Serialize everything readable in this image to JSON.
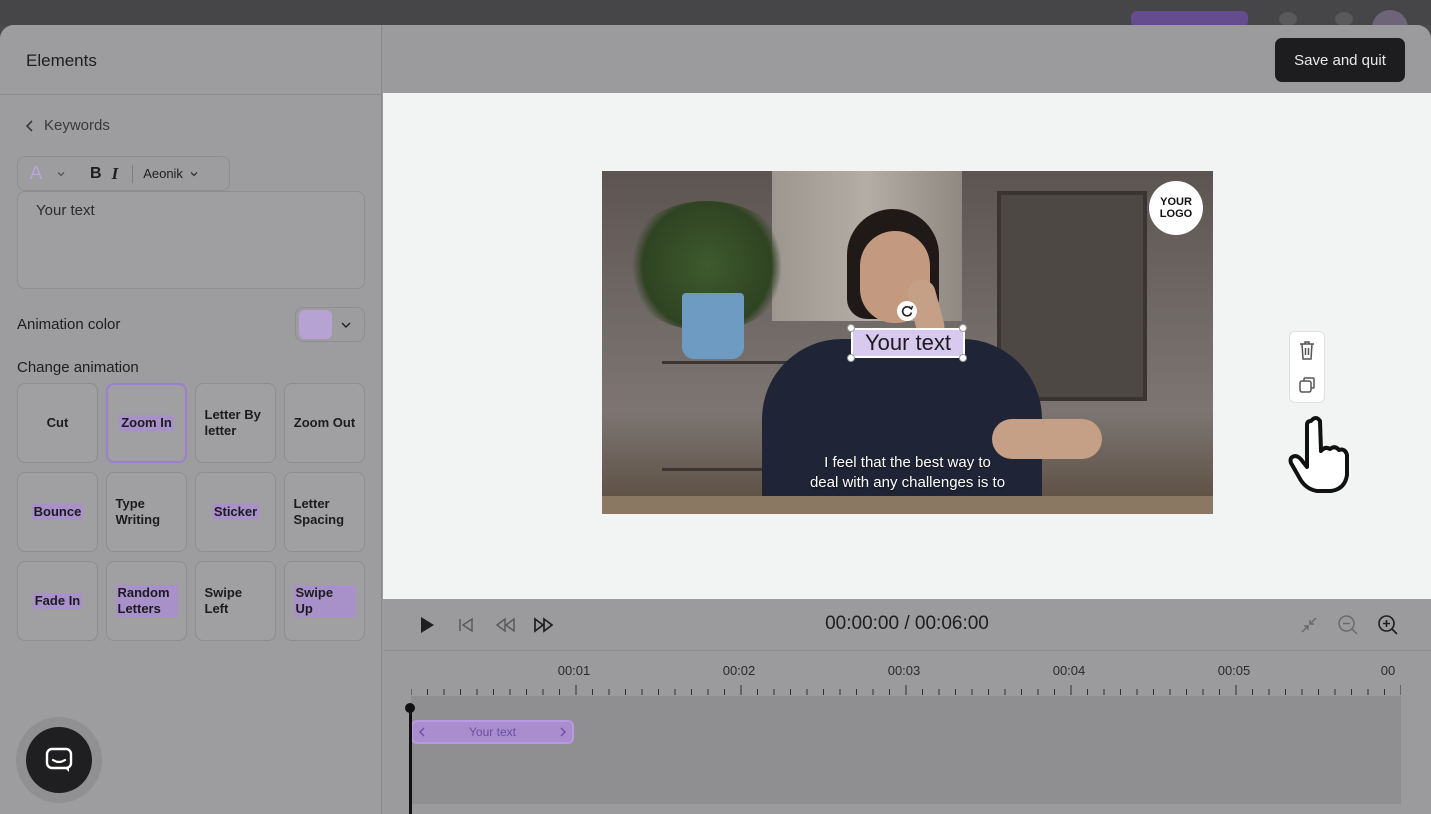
{
  "left_panel": {
    "title": "Elements",
    "back_label": "Keywords",
    "font_name": "Aeonik",
    "text_value": "Your text",
    "animation_color_label": "Animation color",
    "animation_color": "#b6a3d3",
    "change_animation_label": "Change animation",
    "animations": [
      {
        "label": "Cut",
        "selected": false
      },
      {
        "label": "Zoom In",
        "selected": true
      },
      {
        "label": "Letter By letter",
        "selected": false
      },
      {
        "label": "Zoom Out",
        "selected": false
      },
      {
        "label": "Bounce",
        "selected": false
      },
      {
        "label": "Type Writing",
        "selected": false
      },
      {
        "label": "Sticker",
        "selected": false
      },
      {
        "label": "Letter Spacing",
        "selected": false
      },
      {
        "label": "Fade In",
        "selected": false
      },
      {
        "label": "Random Letters",
        "selected": false
      },
      {
        "label": "Swipe Left",
        "selected": false
      },
      {
        "label": "Swipe Up",
        "selected": false
      }
    ]
  },
  "header": {
    "save_label": "Save and quit"
  },
  "canvas": {
    "logo_text": "YOUR LOGO",
    "text_element": "Your text",
    "subtitle_line1": "I feel that the best way to",
    "subtitle_line2": "deal with any challenges is to"
  },
  "timeline": {
    "time_readout": "00:00:00 / 00:06:00",
    "ticks": [
      "00:01",
      "00:02",
      "00:03",
      "00:04",
      "00:05",
      "00"
    ],
    "clip_label": "Your text"
  },
  "icons": {
    "toolbar": [
      "text-color-icon",
      "bold-icon",
      "italic-icon",
      "chevron-down-icon"
    ],
    "side_tools": [
      "trash-icon",
      "duplicate-icon"
    ],
    "playback": [
      "play-icon",
      "skip-start-icon",
      "rewind-icon",
      "fast-forward-icon"
    ],
    "zoom": [
      "collapse-icon",
      "zoom-out-icon",
      "zoom-in-icon"
    ]
  }
}
